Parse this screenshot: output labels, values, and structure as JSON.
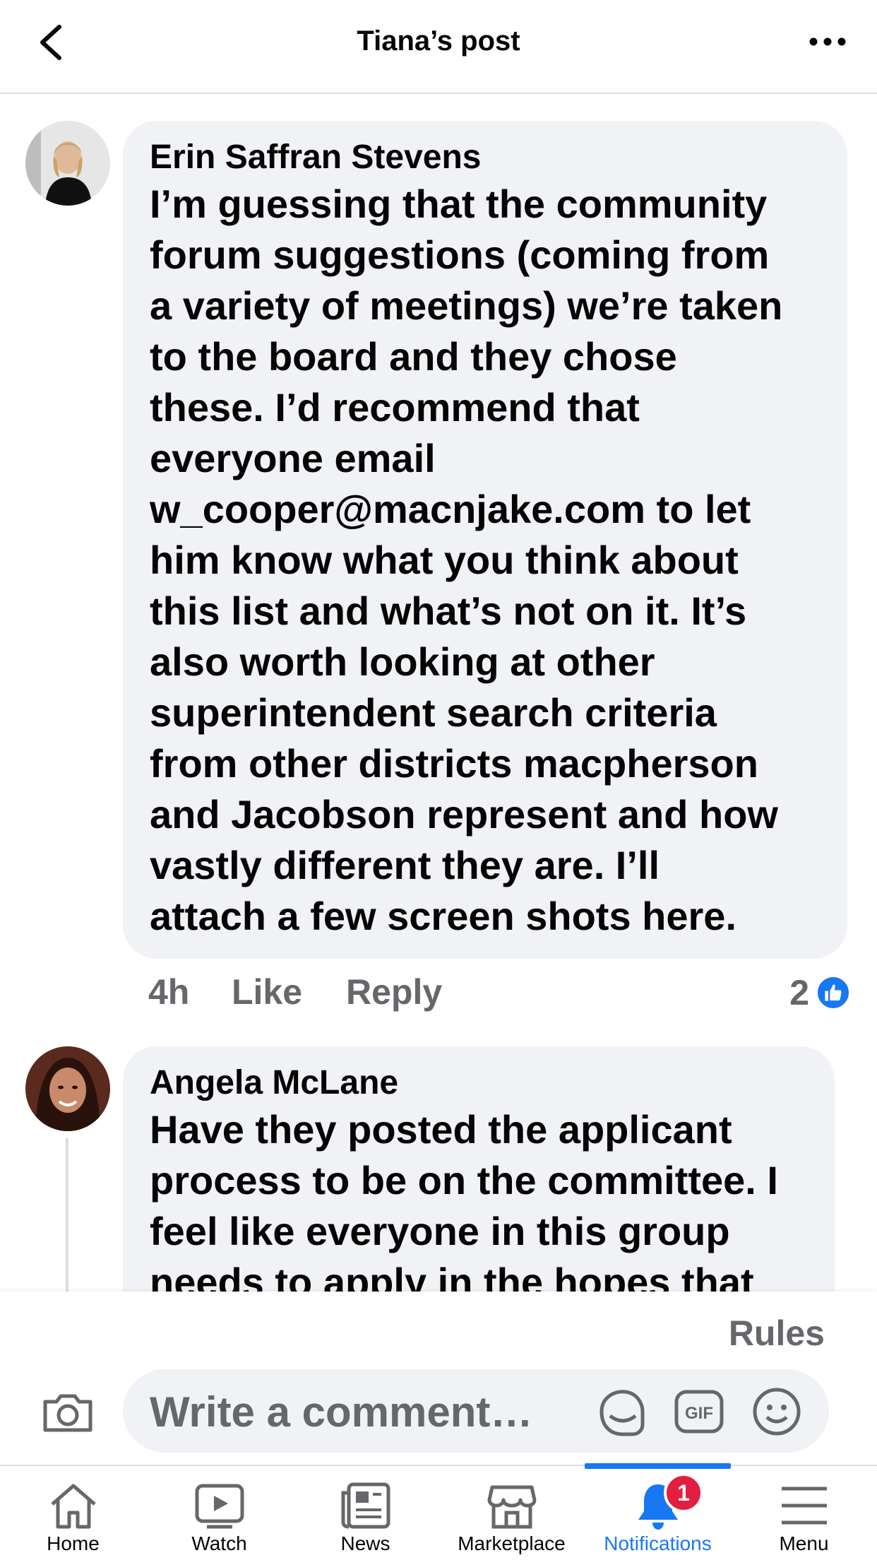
{
  "header": {
    "title": "Tiana’s post",
    "back_icon": "back-chevron-icon",
    "more_icon": "more-dots-icon"
  },
  "comments": [
    {
      "author": "Erin Saffran Stevens",
      "lines": [
        "I’m guessing that the community",
        "forum suggestions (coming from",
        "a variety of meetings) we’re taken",
        "to the board and they chose",
        "these. I’d recommend that",
        "everyone email",
        "w_cooper@macnjake.com to let",
        "him know what you think about",
        "this list and what’s not on it. It’s",
        "also worth looking at other",
        "superintendent search criteria",
        "from other districts macpherson",
        "and Jacobson represent and how",
        "vastly different they are. I’ll",
        "attach a few screen shots here."
      ],
      "time": "4h",
      "like_label": "Like",
      "reply_label": "Reply",
      "reaction_count": "2",
      "reaction_icon": "like-reaction-icon"
    },
    {
      "author": "Angela McLane",
      "lines": [
        "Have they posted the applicant",
        "process to be on the committee. I",
        "feel like everyone in this group",
        "needs to apply in the hopes that"
      ]
    }
  ],
  "composer": {
    "rules_label": "Rules",
    "placeholder": "Write a comment…",
    "camera_icon": "camera-icon",
    "sticker_icon": "sticker-icon",
    "gif_icon": "gif-icon",
    "emoji_icon": "emoji-icon"
  },
  "nav": {
    "items": [
      {
        "label": "Home",
        "icon": "home-icon"
      },
      {
        "label": "Watch",
        "icon": "watch-icon"
      },
      {
        "label": "News",
        "icon": "news-icon"
      },
      {
        "label": "Marketplace",
        "icon": "marketplace-icon"
      },
      {
        "label": "Notifications",
        "icon": "bell-icon",
        "badge": "1",
        "active": true
      },
      {
        "label": "Menu",
        "icon": "menu-icon"
      }
    ]
  },
  "colors": {
    "accent": "#1877f2",
    "bubble": "#f0f2f5",
    "muted": "#65676b",
    "badge": "#e41e3f"
  }
}
